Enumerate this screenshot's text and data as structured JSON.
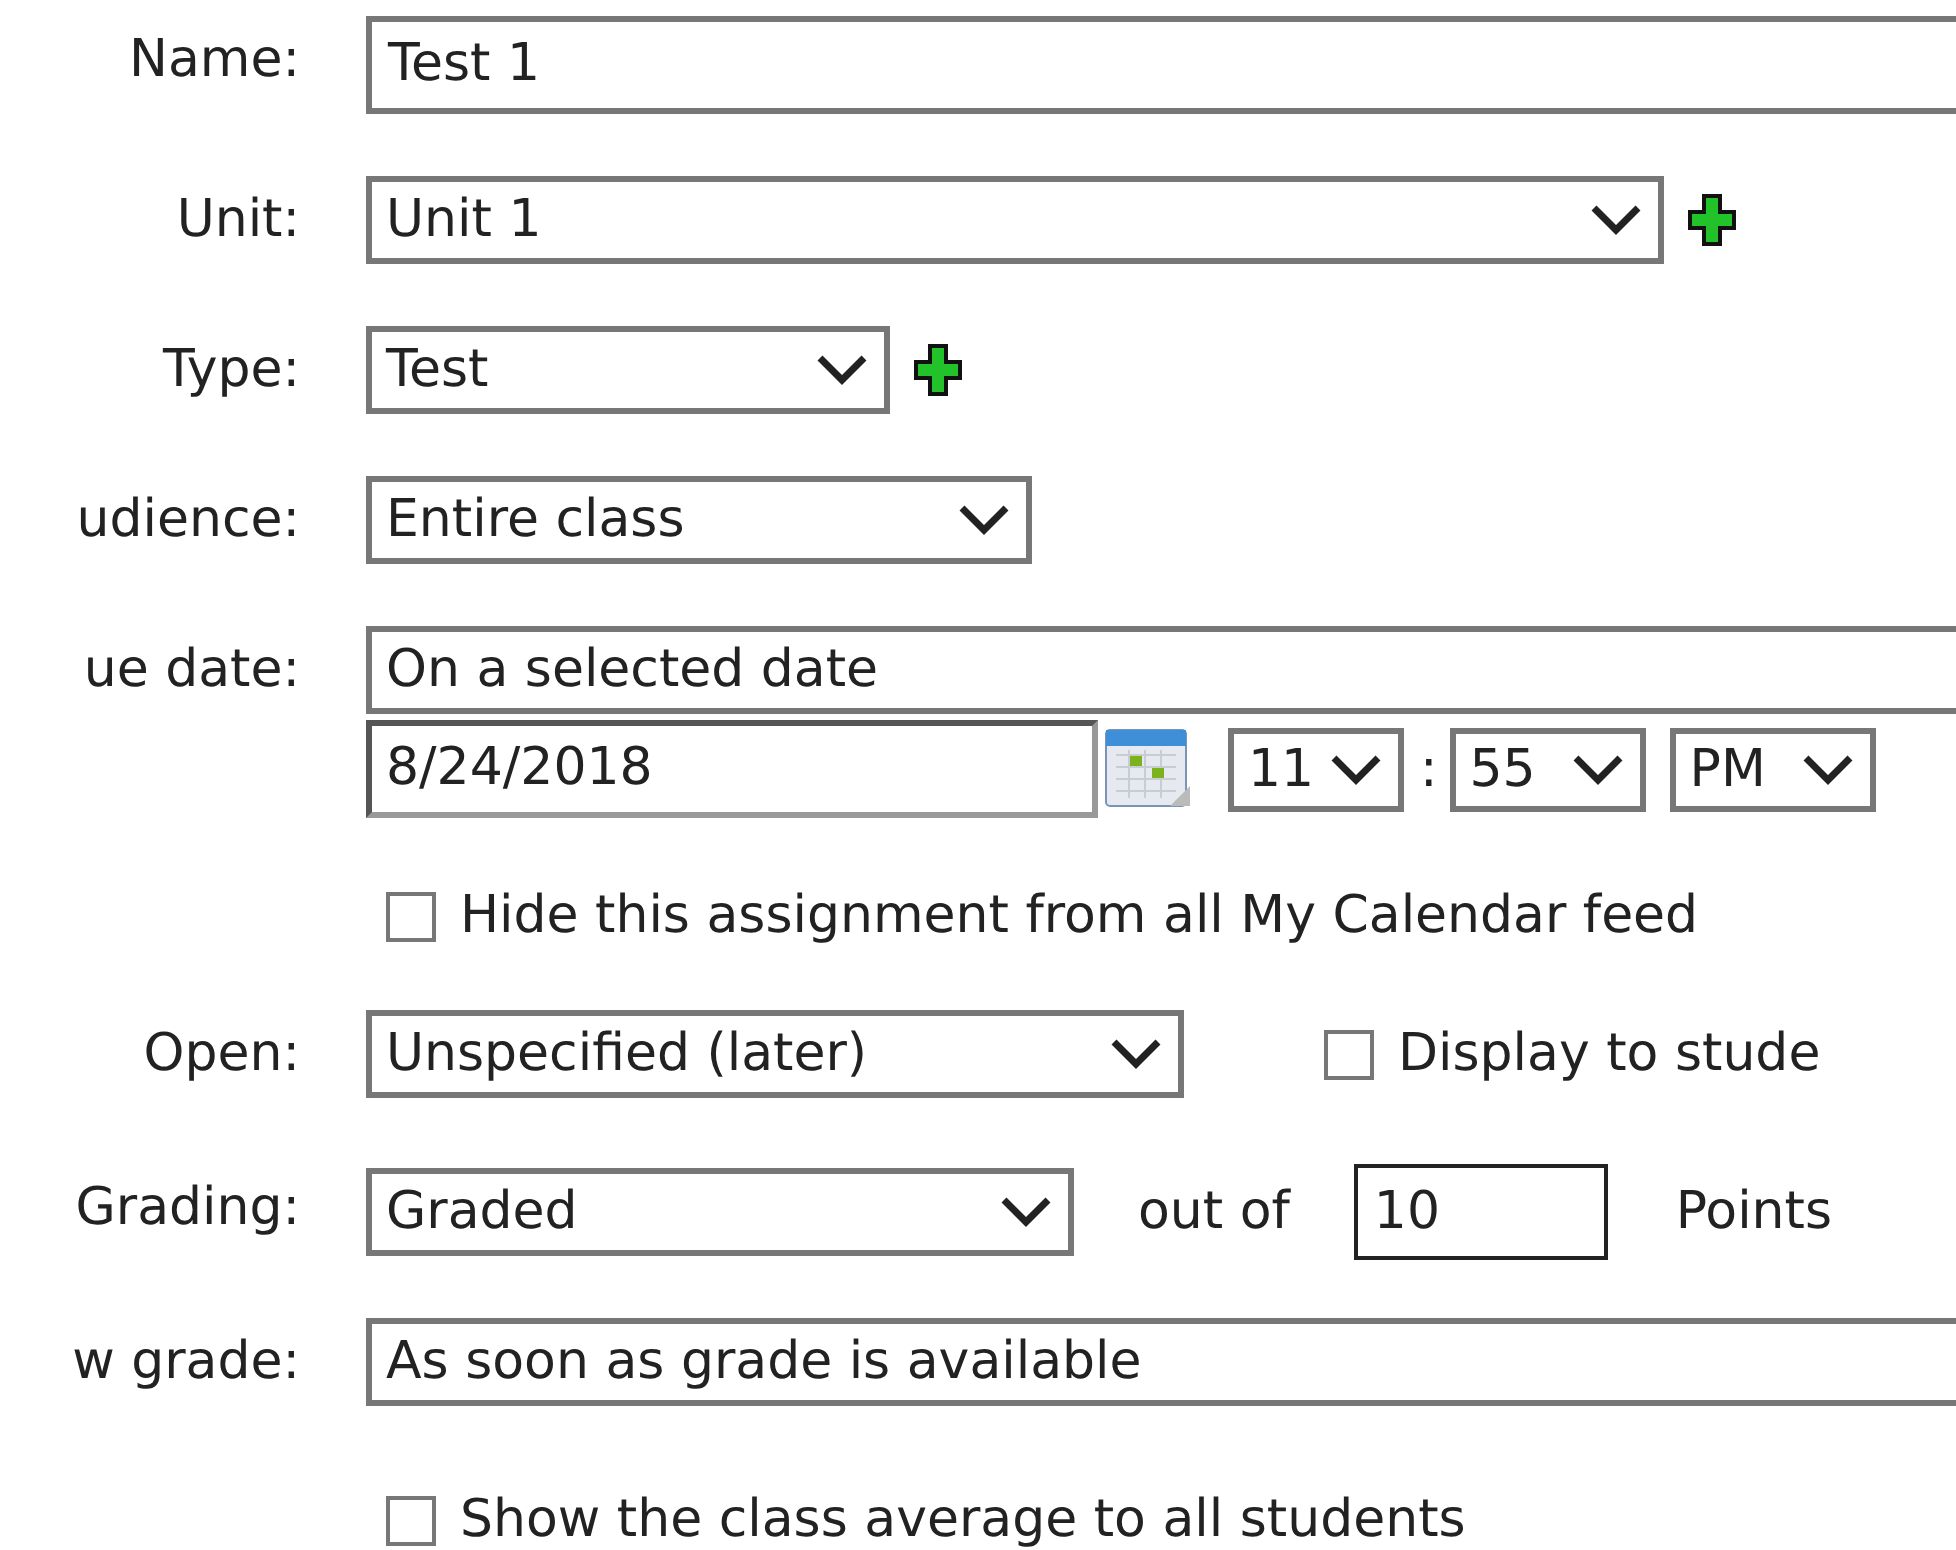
{
  "rows": [
    {
      "kind": "text",
      "label": "Name:",
      "value": "Test 1"
    },
    {
      "kind": "select",
      "label": "Unit:",
      "value": "Unit 1",
      "add": true
    },
    {
      "kind": "select",
      "label": "Type:",
      "value": "Test",
      "add": true
    },
    {
      "kind": "select",
      "label": "udience:",
      "value": "Entire class",
      "add": false
    },
    {
      "kind": "select",
      "label": "ue date:",
      "value": "On a selected date",
      "add": false
    },
    {
      "kind": "datetime",
      "date": "8/24/2018",
      "hour": "11",
      "separator": ":",
      "minute": "55",
      "ampm": "PM"
    },
    {
      "kind": "checkbox",
      "text": "Hide this assignment from all My Calendar feed",
      "checked": false
    },
    {
      "kind": "select",
      "label": "Open:",
      "value": "Unspecified (later)",
      "add": false,
      "checkbox": {
        "text": "Display to stude",
        "checked": false
      }
    },
    {
      "kind": "grading",
      "label": "Grading:",
      "value": "Graded",
      "out_of": "out of",
      "points": "10",
      "unit": "Points"
    },
    {
      "kind": "select",
      "label": "w grade:",
      "value": "As soon as grade is available",
      "add": false
    },
    {
      "kind": "checkbox",
      "text": "Show the class average to all students",
      "checked": false
    }
  ]
}
